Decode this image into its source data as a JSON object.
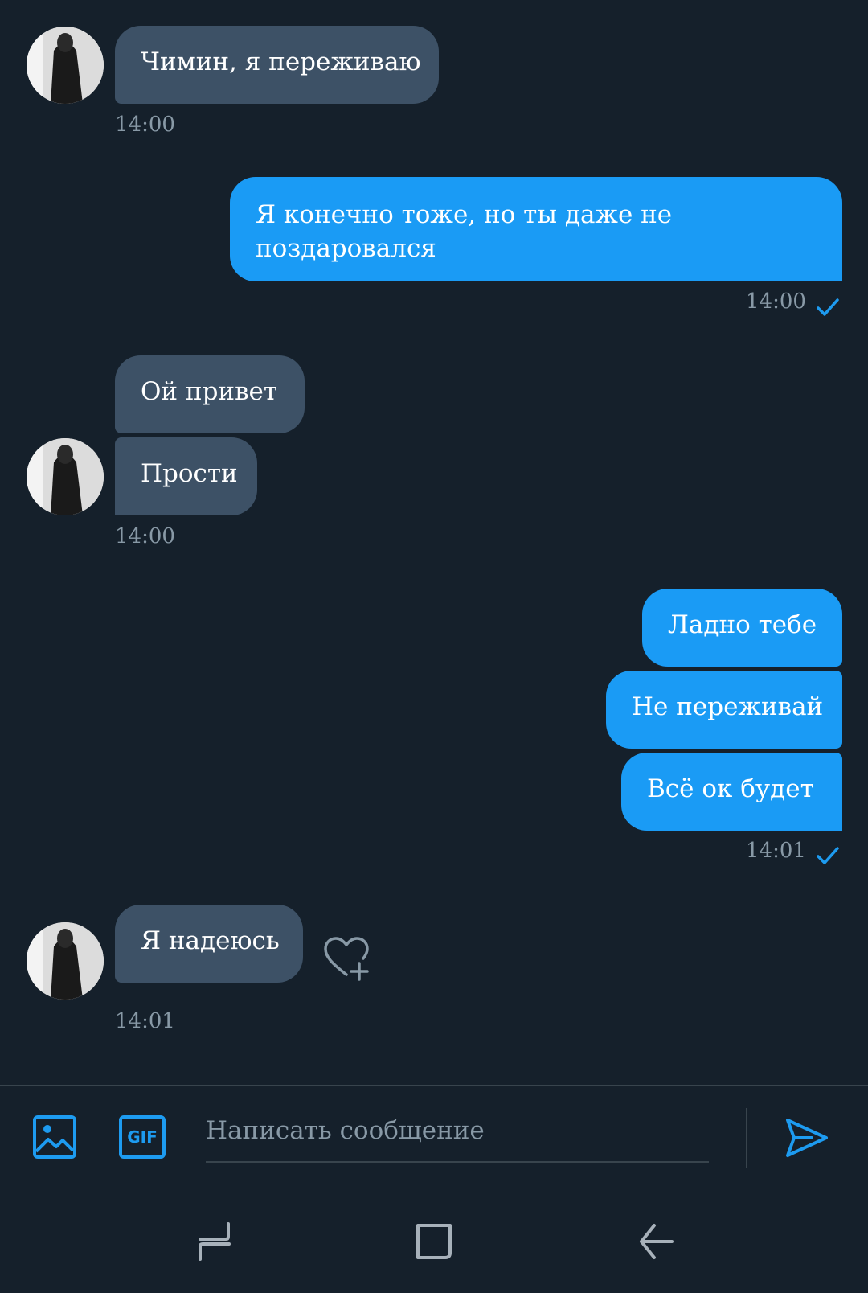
{
  "messages": [
    {
      "side": "in",
      "text": "Чимин, я переживаю",
      "time": "14:00"
    },
    {
      "side": "out",
      "text_line1": "Я конечно тоже, но ты даже не",
      "text_line2": "поздаровался",
      "time": "14:00"
    },
    {
      "side": "in",
      "text": "Ой привет"
    },
    {
      "side": "in",
      "text": "Прости",
      "time": "14:00"
    },
    {
      "side": "out",
      "text": "Ладно тебе"
    },
    {
      "side": "out",
      "text": "Не переживай"
    },
    {
      "side": "out",
      "text": "Всё ок будет",
      "time": "14:01"
    },
    {
      "side": "in",
      "text": "Я надеюсь",
      "time": "14:01"
    }
  ],
  "composer": {
    "placeholder": "Написать сообщение",
    "gif_label": "GIF"
  },
  "colors": {
    "background": "#15202b",
    "incoming_bubble": "#3d5166",
    "outgoing_bubble": "#1a9bf5",
    "accent": "#1d9bf0",
    "muted": "#8899a6"
  },
  "icons": [
    "image-icon",
    "gif-icon",
    "send-icon",
    "heart-plus-icon",
    "read-check-icon",
    "nav-recents-icon",
    "nav-home-icon",
    "nav-back-icon"
  ]
}
